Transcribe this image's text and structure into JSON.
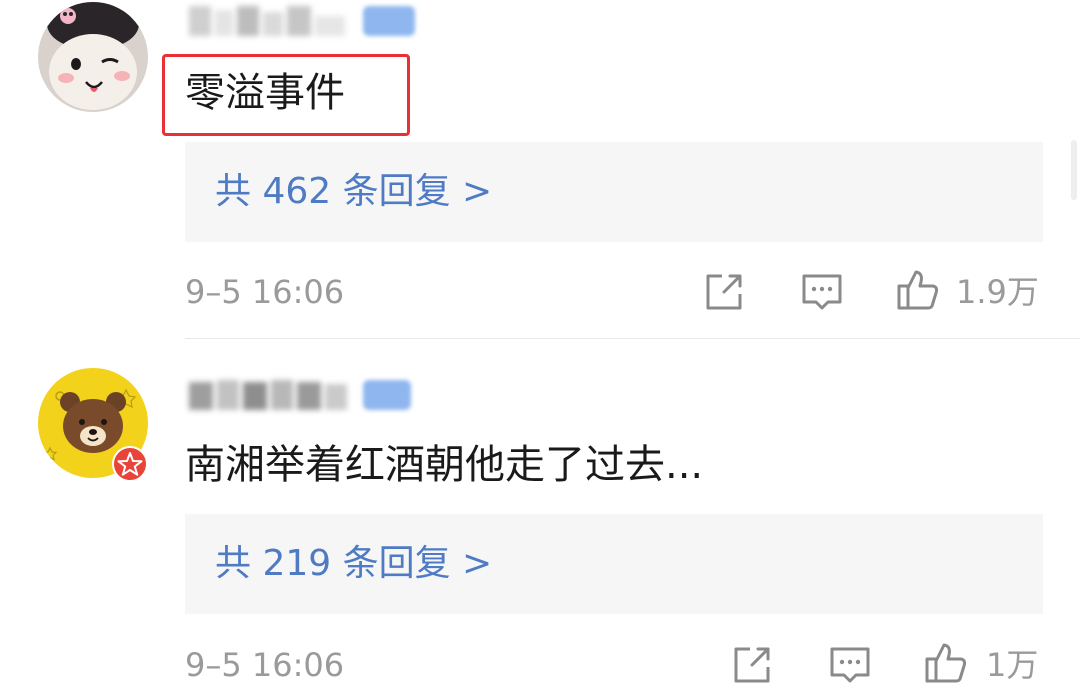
{
  "comments": [
    {
      "content": "零溢事件",
      "replies_label": "共 462 条回复 >",
      "time": "9–5 16:06",
      "like_count": "1.9万",
      "highlighted": true,
      "avatar": "plush-toy-avatar"
    },
    {
      "content": "南湘举着红酒朝他走了过去...",
      "replies_label": "共 219 条回复 >",
      "time": "9–5 16:06",
      "like_count": "1万",
      "highlighted": false,
      "avatar": "brown-bear-avatar"
    }
  ],
  "icons": {
    "share": "share-icon",
    "comment": "comment-icon",
    "like": "thumbs-up-icon",
    "verified": "verified-star-badge-icon"
  },
  "colors": {
    "link": "#4f7bc4",
    "highlight": "#ea2f35",
    "meta": "#9a9a9a",
    "reply_bg": "#f6f6f6"
  }
}
